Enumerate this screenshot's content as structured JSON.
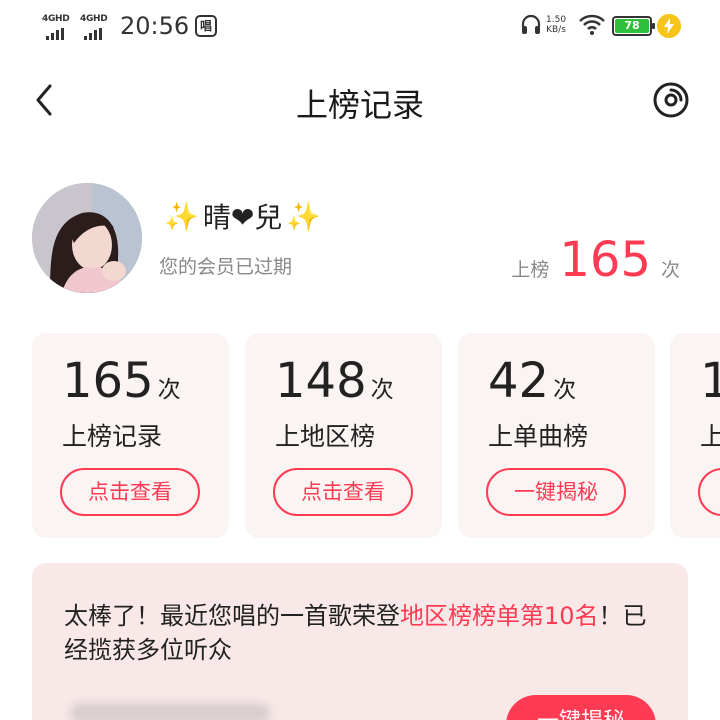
{
  "status_bar": {
    "sim1": "4GHD",
    "sim2": "4GHD",
    "time": "20:56",
    "app_badge": "唱",
    "net_speed_value": "1.50",
    "net_speed_unit": "KB/s",
    "battery": "78"
  },
  "header": {
    "title": "上榜记录"
  },
  "profile": {
    "name_prefix": "✨",
    "name": "晴❤兒",
    "name_suffix": "✨",
    "membership": "您的会员已过期",
    "rank_label": "上榜",
    "rank_count": "165",
    "rank_unit": "次"
  },
  "cards": [
    {
      "count": "165",
      "unit": "次",
      "label": "上榜记录",
      "button": "点击查看"
    },
    {
      "count": "148",
      "unit": "次",
      "label": "上地区榜",
      "button": "点击查看"
    },
    {
      "count": "42",
      "unit": "次",
      "label": "上单曲榜",
      "button": "一键揭秘"
    },
    {
      "count": "1",
      "unit": "",
      "label": "上",
      "button": ""
    }
  ],
  "banner": {
    "text_before": "太棒了！最近您唱的一首歌荣登",
    "highlight": "地区榜榜单第10名",
    "text_after": "！已经揽获多位听众",
    "cta": "一键揭秘"
  },
  "colors": {
    "accent": "#ff3b54",
    "card_bg": "#faf4f3",
    "banner_bg": "#f8e8e8",
    "battery": "#2fbf3a"
  }
}
